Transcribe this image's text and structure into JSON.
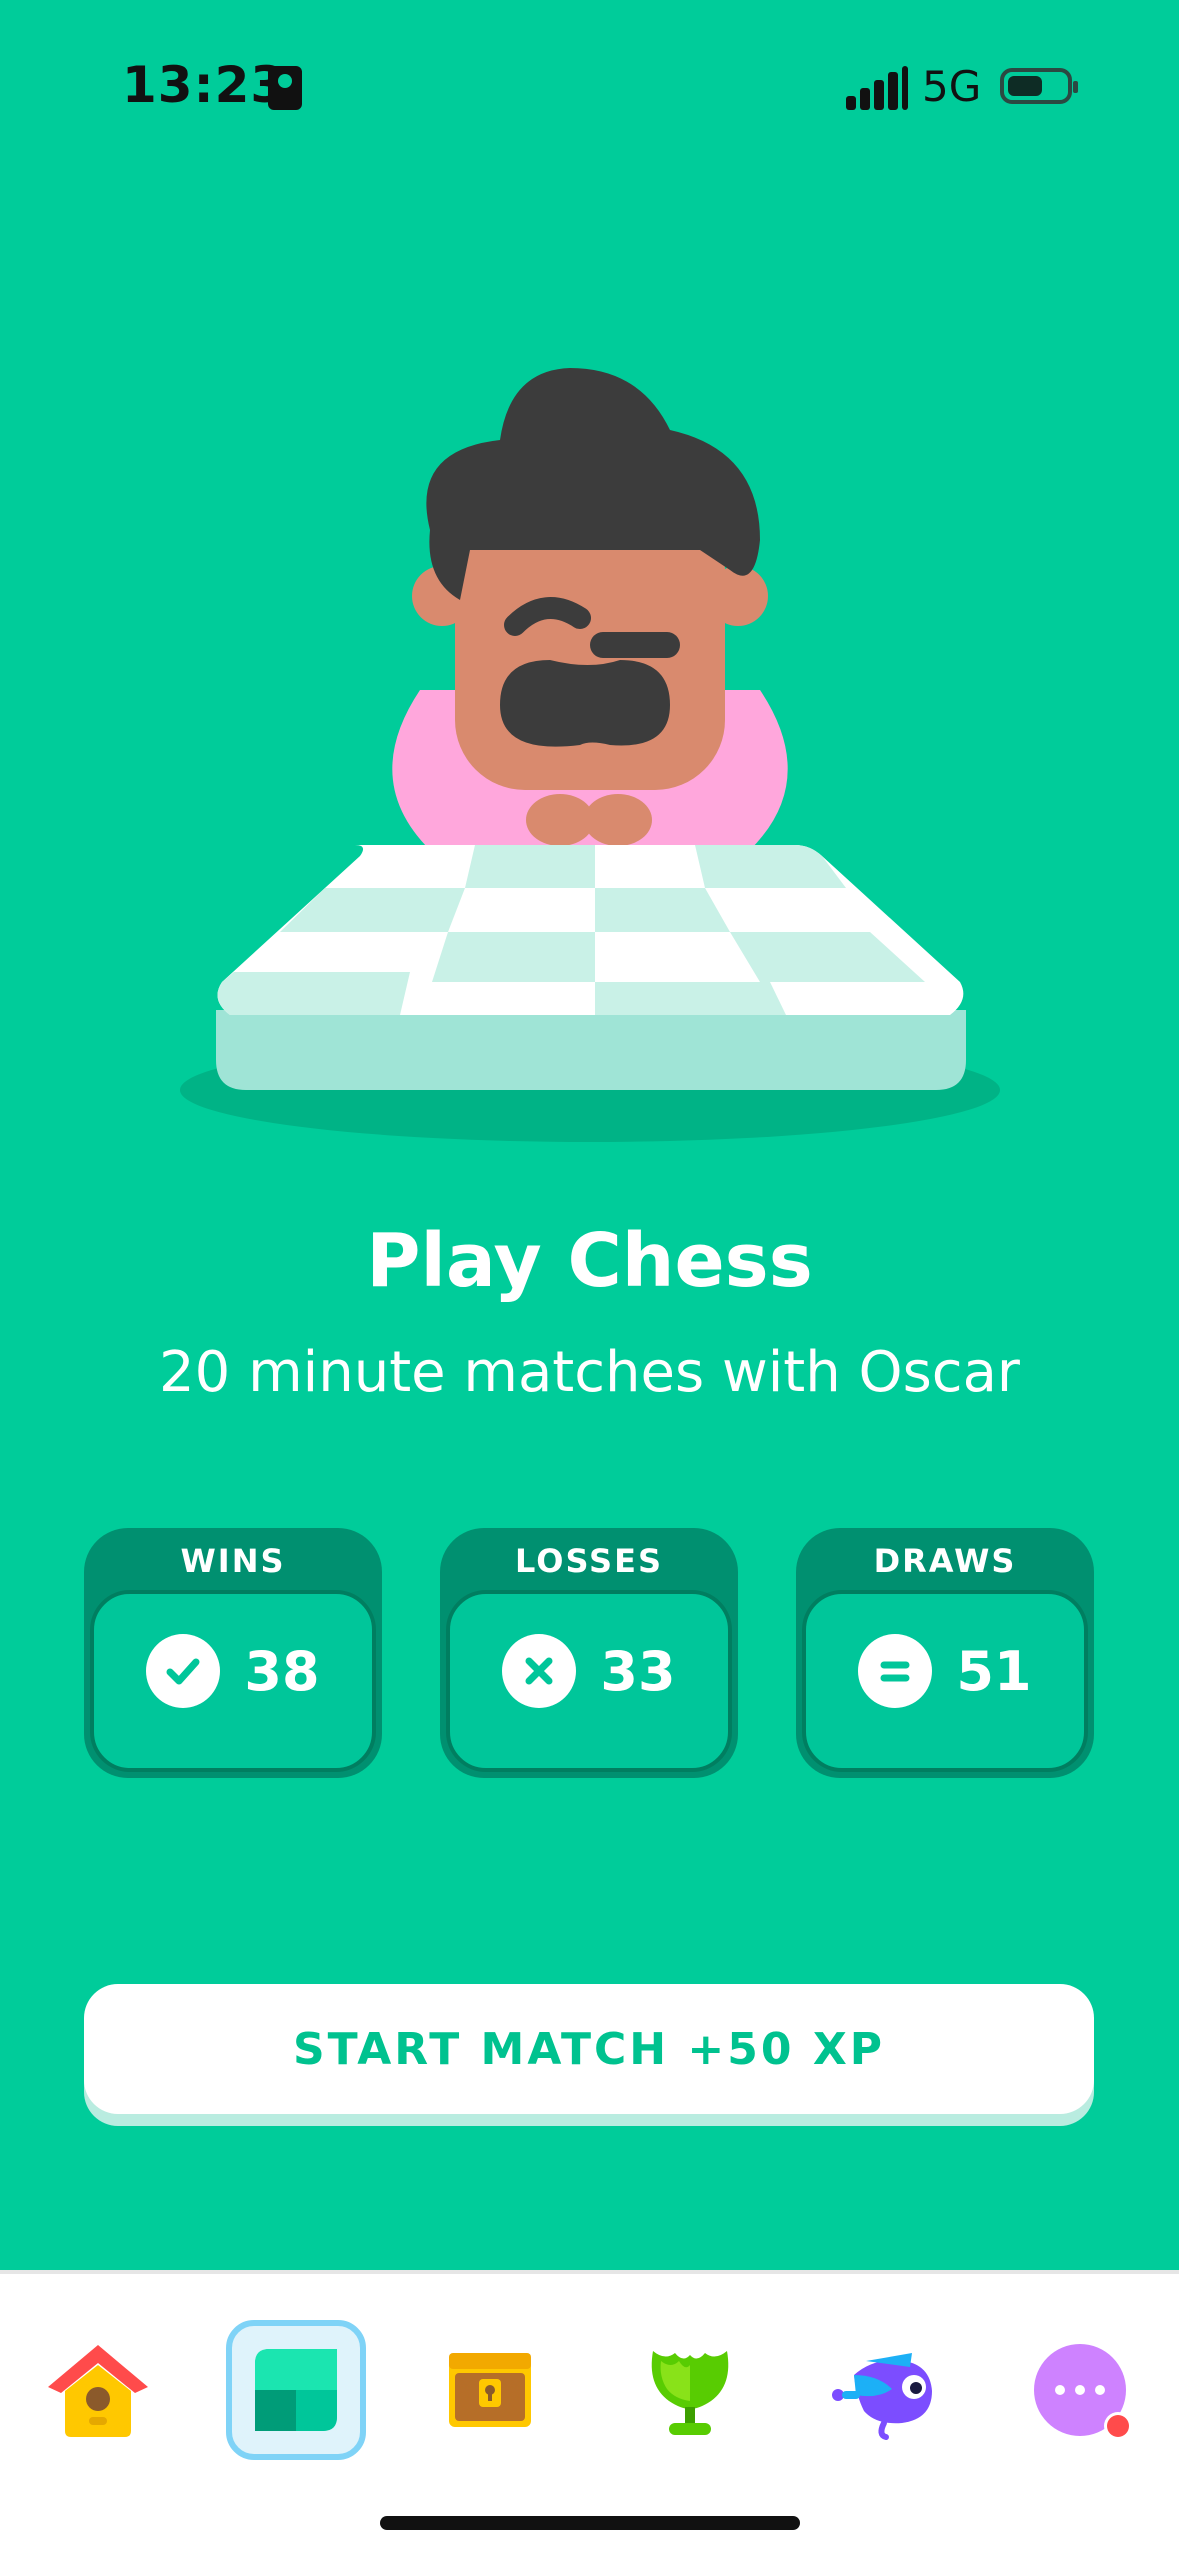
{
  "status": {
    "time": "13:23",
    "network": "5G"
  },
  "hero": {
    "title": "Play Chess",
    "subtitle": "20 minute matches with Oscar"
  },
  "stats": [
    {
      "label": "WINS",
      "value": "38",
      "icon": "check-icon"
    },
    {
      "label": "LOSSES",
      "value": "33",
      "icon": "x-icon"
    },
    {
      "label": "DRAWS",
      "value": "51",
      "icon": "equals-icon"
    }
  ],
  "start_button": {
    "label": "START MATCH +50 XP"
  },
  "tabs": [
    {
      "name": "home",
      "icon": "birdhouse-icon",
      "active": false
    },
    {
      "name": "chess",
      "icon": "chessboard-icon",
      "active": true
    },
    {
      "name": "chest",
      "icon": "treasure-chest-icon",
      "active": false
    },
    {
      "name": "league",
      "icon": "trophy-icon",
      "active": false
    },
    {
      "name": "bird",
      "icon": "bird-icon",
      "active": false
    },
    {
      "name": "more",
      "icon": "more-icon",
      "active": false,
      "notification": true
    }
  ],
  "colors": {
    "background": "#00cc9a",
    "accent": "#00c28f",
    "card_dark": "#009070"
  }
}
